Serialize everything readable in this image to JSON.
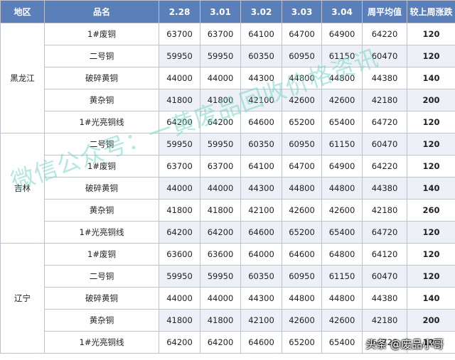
{
  "headers": [
    "地区",
    "品名",
    "2.28",
    "3.01",
    "3.02",
    "3.03",
    "3.04",
    "周平均值",
    "较上周涨跌"
  ],
  "groups": [
    {
      "region": "黑龙江",
      "rows": [
        {
          "name": "1#废铜",
          "values": [
            "63700",
            "63700",
            "64100",
            "64700",
            "64900",
            "64220"
          ],
          "change": "120"
        },
        {
          "name": "二号铜",
          "values": [
            "59950",
            "59950",
            "60350",
            "60950",
            "61150",
            "60470"
          ],
          "change": "120"
        },
        {
          "name": "破碎黄铜",
          "values": [
            "44000",
            "44000",
            "44300",
            "44800",
            "44800",
            "44380"
          ],
          "change": "140"
        },
        {
          "name": "黄杂铜",
          "values": [
            "41800",
            "41800",
            "42100",
            "42600",
            "42600",
            "42180"
          ],
          "change": "200"
        },
        {
          "name": "1#光亮铜线",
          "values": [
            "64200",
            "64200",
            "64600",
            "65200",
            "65400",
            "64720"
          ],
          "change": "120"
        }
      ]
    },
    {
      "region": "吉林",
      "rows": [
        {
          "name": "二号铜",
          "values": [
            "59950",
            "59950",
            "60350",
            "60950",
            "61150",
            "60470"
          ],
          "change": "120"
        },
        {
          "name": "1#废铜",
          "values": [
            "63700",
            "63700",
            "64100",
            "64700",
            "64900",
            "64220"
          ],
          "change": "120"
        },
        {
          "name": "破碎黄铜",
          "values": [
            "44000",
            "44000",
            "44300",
            "44800",
            "44800",
            "44380"
          ],
          "change": "140"
        },
        {
          "name": "黄杂铜",
          "values": [
            "41800",
            "41800",
            "42100",
            "42600",
            "42600",
            "42180"
          ],
          "change": "260"
        },
        {
          "name": "1#光亮铜线",
          "values": [
            "64200",
            "64200",
            "64600",
            "65200",
            "65400",
            "64720"
          ],
          "change": "120"
        }
      ]
    },
    {
      "region": "辽宁",
      "rows": [
        {
          "name": "1#废铜",
          "values": [
            "63600",
            "63600",
            "64000",
            "64600",
            "64800",
            "64120"
          ],
          "change": "120"
        },
        {
          "name": "二号铜",
          "values": [
            "59950",
            "59950",
            "60350",
            "60950",
            "61150",
            "60470"
          ],
          "change": "120"
        },
        {
          "name": "破碎黄铜",
          "values": [
            "44000",
            "44000",
            "44300",
            "44800",
            "44800",
            "44380"
          ],
          "change": "140"
        },
        {
          "name": "黄杂铜",
          "values": [
            "41800",
            "41800",
            "42100",
            "42600",
            "42600",
            "42180"
          ],
          "change": "200"
        },
        {
          "name": "1#光亮铜线",
          "values": [
            "64200",
            "64200",
            "64600",
            "65200",
            "65400",
            "64720"
          ],
          "change": "120"
        }
      ]
    }
  ],
  "watermark": "微信公众号：一黄废品回收价格资讯",
  "footer_mark": "头条 @废品小哥",
  "colors": {
    "header_bg": "#5b7fb8",
    "change_text": "#e21818",
    "stripe": "#edf0f7",
    "watermark": "#78d6c4"
  }
}
